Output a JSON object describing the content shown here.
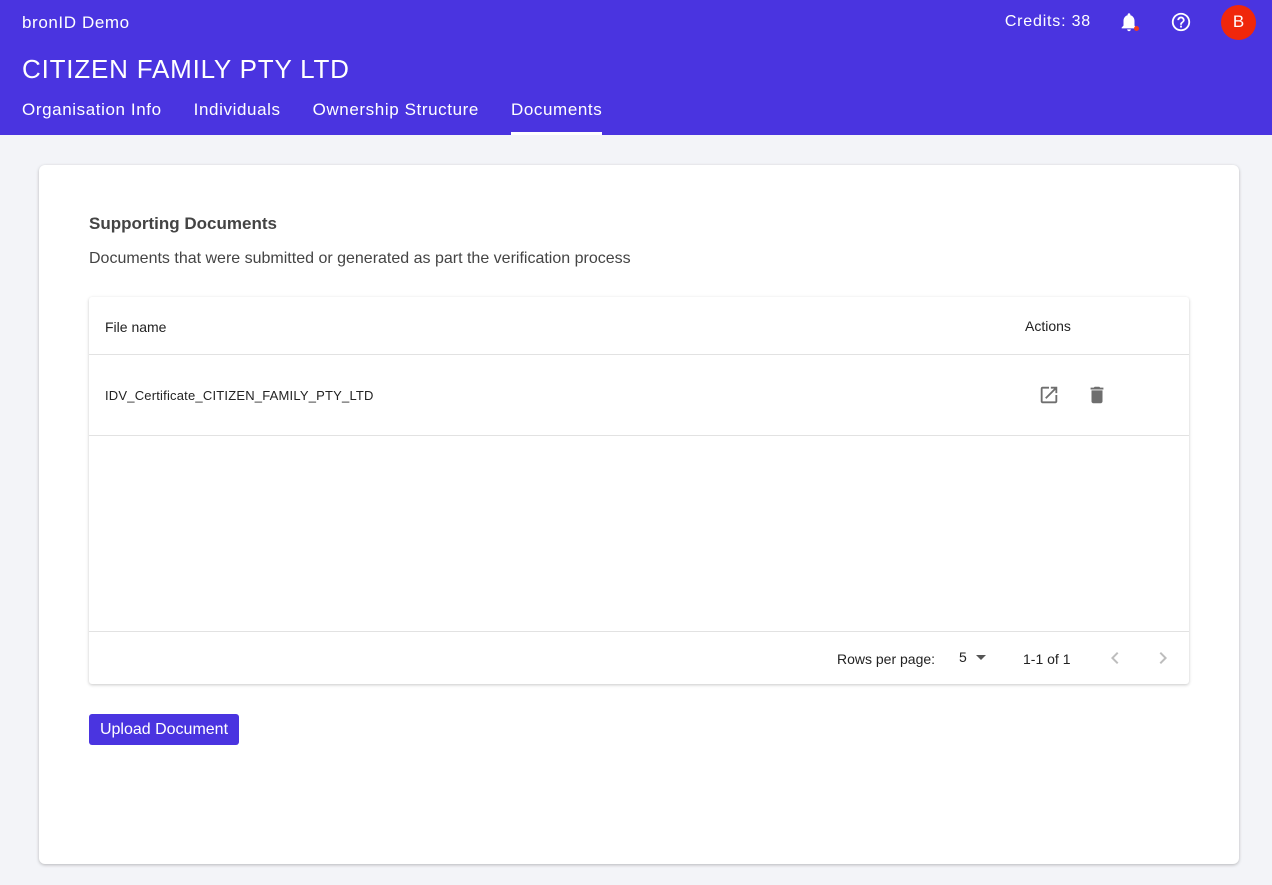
{
  "app": {
    "name": "bronID Demo",
    "credits": "Credits: 38"
  },
  "icons": {
    "notifications": "bell-icon",
    "help": "help-circle-icon",
    "open": "open-in-new-icon",
    "delete": "trash-icon",
    "prev": "chevron-left-icon",
    "next": "chevron-right-icon"
  },
  "colors": {
    "primary": "#4a34e0",
    "avatar": "#f0270b",
    "notification_dot": "#f23c1c"
  },
  "user": {
    "avatar_initial": "B"
  },
  "org": {
    "title": "CITIZEN FAMILY PTY LTD"
  },
  "tabs": [
    {
      "label": "Organisation Info",
      "active": false
    },
    {
      "label": "Individuals",
      "active": false
    },
    {
      "label": "Ownership Structure",
      "active": false
    },
    {
      "label": "Documents",
      "active": true
    }
  ],
  "documents": {
    "title": "Supporting Documents",
    "description": "Documents that were submitted or generated as part the verification process",
    "columns": {
      "file_name": "File name",
      "actions": "Actions"
    },
    "rows": [
      {
        "file_name": "IDV_Certificate_CITIZEN_FAMILY_PTY_LTD"
      }
    ],
    "pagination": {
      "rows_per_page_label": "Rows per page:",
      "rows_per_page": "5",
      "range": "1-1 of 1"
    },
    "upload_label": "Upload Document"
  }
}
